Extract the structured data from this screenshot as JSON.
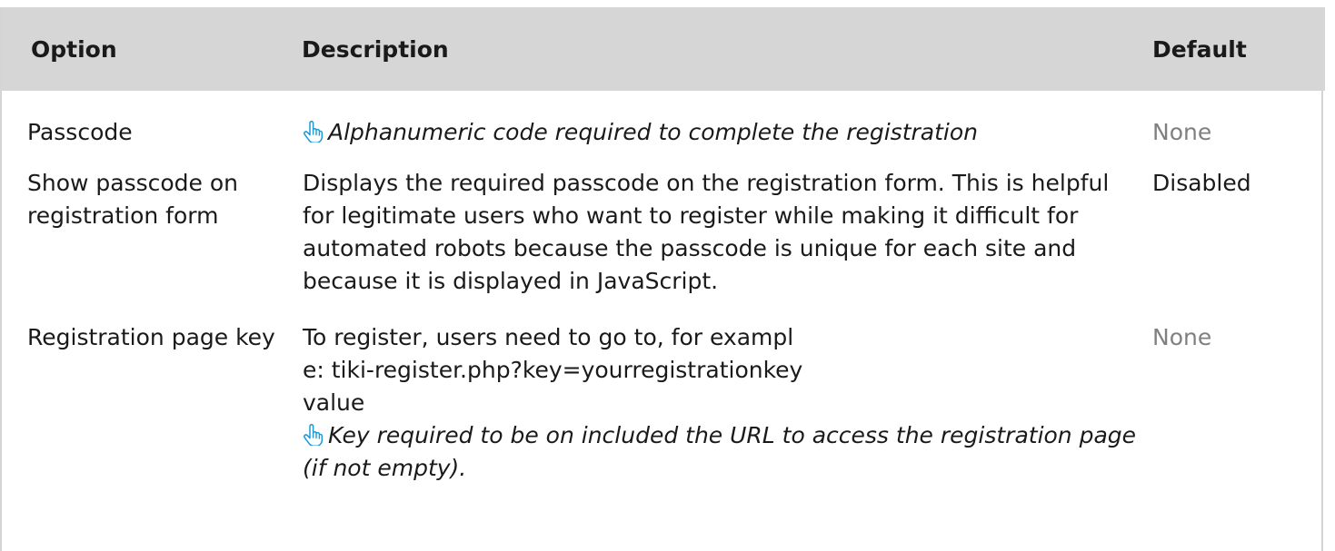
{
  "header": {
    "option": "Option",
    "description": "Description",
    "default": "Default"
  },
  "rows": [
    {
      "option": "Passcode",
      "description": "",
      "hint": "Alphanumeric code required to complete the registration",
      "hint_icon": "pointing-hand-icon",
      "default": "None"
    },
    {
      "option": "Show passcode on registration form",
      "description": "Displays the required passcode on the registration form. This is helpful for legitimate users who want to register while making it difficult for automated robots because the passcode is unique for each site and because it is displayed in JavaScript.",
      "default": "Disabled"
    },
    {
      "option": "Registration page key",
      "description": "To register, users need to go to, for example: tiki-register.php?key=yourregistrationkeyvalue",
      "hint": "Key required to be on included the URL to access the registration page (if not empty).",
      "hint_icon": "pointing-hand-icon",
      "default": "None"
    }
  ],
  "colors": {
    "header_bg": "#d6d6d6",
    "icon": "#1e9ad6",
    "muted_text": "#808080"
  }
}
